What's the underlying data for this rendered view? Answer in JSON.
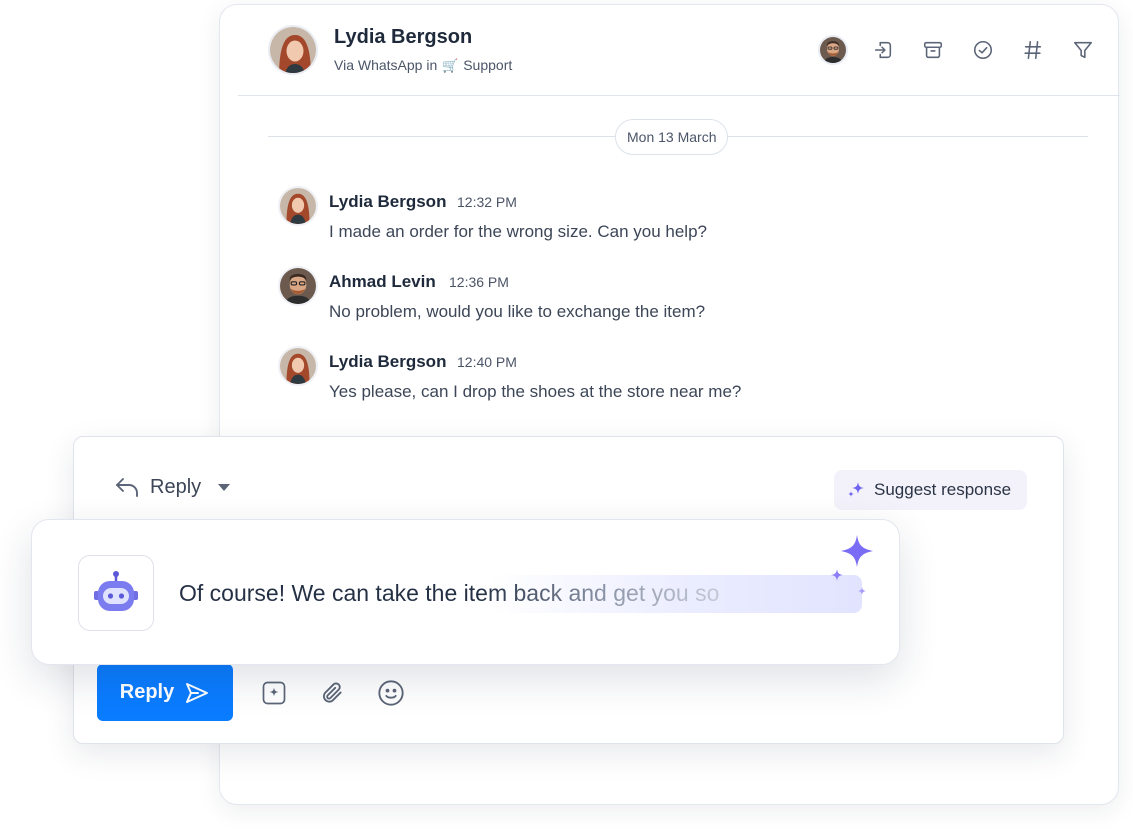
{
  "conversation": {
    "contact_name": "Lydia Bergson",
    "channel_prefix": "Via WhatsApp in",
    "inbox_icon": "🛒",
    "inbox_name": "Support",
    "actions": [
      "assignee-avatar",
      "move-icon",
      "archive-icon",
      "resolve-icon",
      "tag-icon",
      "filter-icon"
    ],
    "date_separator": "Mon 13 March",
    "messages": [
      {
        "author": "Lydia Bergson",
        "time": "12:32 PM",
        "text": "I made an order for the wrong size. Can you help?"
      },
      {
        "author": "Ahmad Levin",
        "time": "12:36 PM",
        "text": "No problem, would you like to exchange the item?"
      },
      {
        "author": "Lydia Bergson",
        "time": "12:40 PM",
        "text": "Yes please, can I drop the shoes at the store near me?"
      }
    ]
  },
  "composer": {
    "mode_label": "Reply",
    "suggest_label": "Suggest response",
    "send_label": "Reply",
    "tools": [
      "ai-compose-icon",
      "attachment-icon",
      "emoji-icon"
    ]
  },
  "ai_suggestion": {
    "text": "Of course! We can take the item back and get you so"
  },
  "colors": {
    "accent": "#0a7cff",
    "sparkle": "#7b6cf6",
    "suggest_bg": "#f3f2fb"
  }
}
